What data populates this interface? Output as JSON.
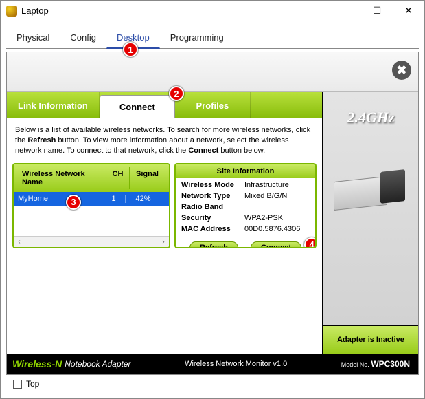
{
  "window": {
    "title": "Laptop"
  },
  "outer_tabs": [
    "Physical",
    "Config",
    "Desktop",
    "Programming"
  ],
  "outer_tabs_active": 2,
  "callouts": {
    "c1": "1",
    "c2": "2",
    "c3": "3",
    "c4": "4"
  },
  "wireless_tabs": {
    "link_info": "Link Information",
    "connect": "Connect",
    "profiles": "Profiles",
    "active": "connect"
  },
  "instructions_html": "Below is a list of available wireless networks. To search for more wireless networks, click the <b>Refresh</b> button. To view more information about a network, select the wireless network name. To connect to that network, click the <b>Connect</b> button below.",
  "network_table": {
    "headers": {
      "name": "Wireless Network Name",
      "ch": "CH",
      "signal": "Signal"
    },
    "rows": [
      {
        "name": "MyHome",
        "ch": "1",
        "signal": "42%"
      }
    ]
  },
  "site_info": {
    "title": "Site Information",
    "fields": {
      "wireless_mode": {
        "label": "Wireless Mode",
        "value": "Infrastructure"
      },
      "network_type": {
        "label": "Network Type",
        "value": "Mixed B/G/N"
      },
      "radio_band": {
        "label": "Radio Band",
        "value": ""
      },
      "security": {
        "label": "Security",
        "value": "WPA2-PSK"
      },
      "mac": {
        "label": "MAC Address",
        "value": "00D0.5876.4306"
      }
    }
  },
  "buttons": {
    "refresh": "Refresh",
    "connect": "Connect"
  },
  "side": {
    "band": "2.4GHz",
    "status": "Adapter is Inactive"
  },
  "footer": {
    "brand": "Wireless-N",
    "product": "Notebook Adapter",
    "center": "Wireless Network Monitor  v1.0",
    "model_prefix": "Model No.",
    "model": "WPC300N"
  },
  "bottom_checkbox": {
    "label": "Top",
    "checked": false
  }
}
